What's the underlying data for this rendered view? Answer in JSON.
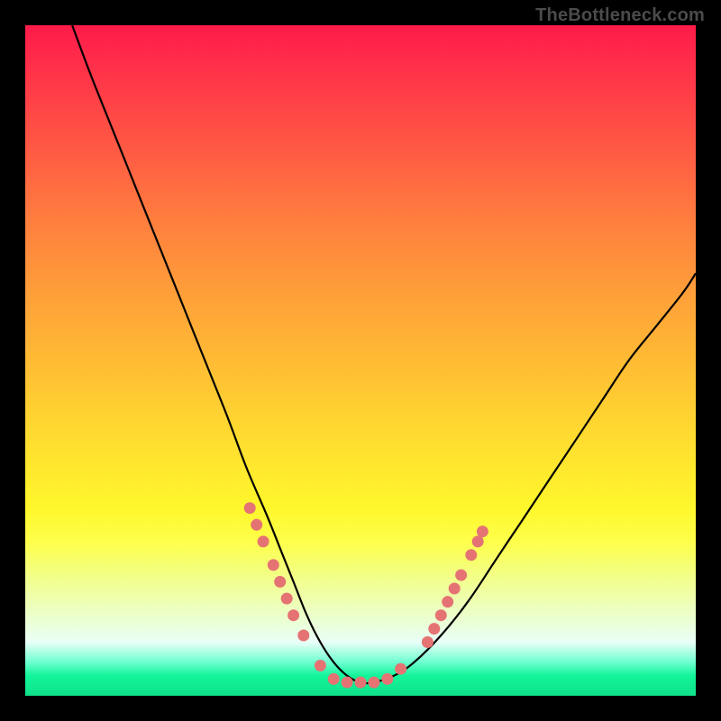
{
  "watermark": "TheBottleneck.com",
  "chart_data": {
    "type": "line",
    "title": "",
    "xlabel": "",
    "ylabel": "",
    "xlim": [
      0,
      100
    ],
    "ylim": [
      0,
      100
    ],
    "grid": false,
    "legend": "none",
    "series": [
      {
        "name": "bottleneck-curve",
        "color": "#000000",
        "x": [
          7,
          10,
          14,
          18,
          22,
          26,
          30,
          33,
          36,
          38,
          40,
          42,
          44,
          46,
          48,
          50,
          52,
          55,
          58,
          62,
          66,
          70,
          74,
          78,
          82,
          86,
          90,
          94,
          98,
          100
        ],
        "y": [
          100,
          92,
          82,
          72,
          62,
          52,
          42,
          34,
          27,
          22,
          17,
          12,
          8,
          5,
          3,
          2,
          2,
          3,
          5,
          9,
          14,
          20,
          26,
          32,
          38,
          44,
          50,
          55,
          60,
          63
        ]
      }
    ],
    "markers": {
      "name": "salmon-dots",
      "color": "#e57373",
      "points": [
        {
          "x": 33.5,
          "y": 28
        },
        {
          "x": 34.5,
          "y": 25.5
        },
        {
          "x": 35.5,
          "y": 23
        },
        {
          "x": 37,
          "y": 19.5
        },
        {
          "x": 38,
          "y": 17
        },
        {
          "x": 39,
          "y": 14.5
        },
        {
          "x": 40,
          "y": 12
        },
        {
          "x": 41.5,
          "y": 9
        },
        {
          "x": 44,
          "y": 4.5
        },
        {
          "x": 46,
          "y": 2.5
        },
        {
          "x": 48,
          "y": 2
        },
        {
          "x": 50,
          "y": 2
        },
        {
          "x": 52,
          "y": 2
        },
        {
          "x": 54,
          "y": 2.5
        },
        {
          "x": 56,
          "y": 4
        },
        {
          "x": 60,
          "y": 8
        },
        {
          "x": 61,
          "y": 10
        },
        {
          "x": 62,
          "y": 12
        },
        {
          "x": 63,
          "y": 14
        },
        {
          "x": 64,
          "y": 16
        },
        {
          "x": 65,
          "y": 18
        },
        {
          "x": 66.5,
          "y": 21
        },
        {
          "x": 67.5,
          "y": 23
        },
        {
          "x": 68.2,
          "y": 24.5
        }
      ]
    },
    "gradient_stops": [
      {
        "pos": 0,
        "color": "#ff1b4a"
      },
      {
        "pos": 18,
        "color": "#ff5844"
      },
      {
        "pos": 38,
        "color": "#ff993a"
      },
      {
        "pos": 58,
        "color": "#ffd231"
      },
      {
        "pos": 77,
        "color": "#fdff4a"
      },
      {
        "pos": 92,
        "color": "#e9fff7"
      },
      {
        "pos": 100,
        "color": "#0fe18b"
      }
    ]
  }
}
